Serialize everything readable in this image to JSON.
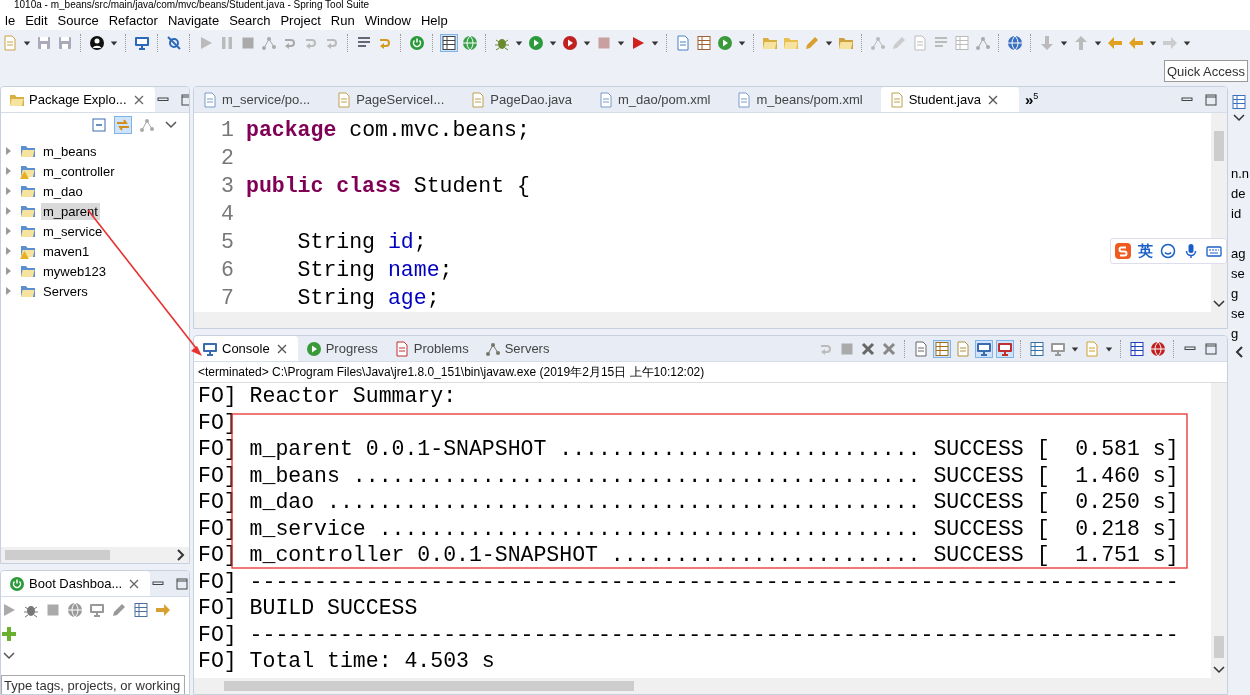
{
  "window": {
    "title": "1010a - m_beans/src/main/java/com/mvc/beans/Student.java - Spring Tool Suite"
  },
  "menu": [
    "le",
    "Edit",
    "Source",
    "Refactor",
    "Navigate",
    "Search",
    "Project",
    "Run",
    "Window",
    "Help"
  ],
  "quick_access": {
    "placeholder": "Quick Access"
  },
  "package_explorer": {
    "title": "Package Explo...",
    "items": [
      {
        "label": "m_beans",
        "selected": false,
        "warning": false
      },
      {
        "label": "m_controller",
        "selected": false,
        "warning": true
      },
      {
        "label": "m_dao",
        "selected": false,
        "warning": false
      },
      {
        "label": "m_parent",
        "selected": true,
        "warning": false
      },
      {
        "label": "m_service",
        "selected": false,
        "warning": false
      },
      {
        "label": "maven1",
        "selected": false,
        "warning": true
      },
      {
        "label": "myweb123",
        "selected": false,
        "warning": false
      },
      {
        "label": "Servers",
        "selected": false,
        "warning": false
      }
    ]
  },
  "boot_dashboard": {
    "title": "Boot Dashboa...",
    "filter": {
      "placeholder": "Type tags, projects, or working"
    }
  },
  "editor": {
    "tabs": [
      {
        "label": "m_service/po...",
        "kind": "xml",
        "selected": false
      },
      {
        "label": "PageServiceI...",
        "kind": "java",
        "selected": false
      },
      {
        "label": "PageDao.java",
        "kind": "java",
        "selected": false
      },
      {
        "label": "m_dao/pom.xml",
        "kind": "xml",
        "selected": false
      },
      {
        "label": "m_beans/pom.xml",
        "kind": "xml",
        "selected": false
      },
      {
        "label": "Student.java",
        "kind": "java",
        "selected": true
      }
    ],
    "overflow": "»",
    "overflow_count": "5",
    "lines": [
      {
        "number": "1",
        "tokens": [
          {
            "text": "package",
            "kind": "keyword"
          },
          {
            "text": " com.mvc.beans;",
            "kind": "plain"
          }
        ]
      },
      {
        "number": "2"
      },
      {
        "number": "3",
        "tokens": [
          {
            "text": "public class",
            "kind": "keyword"
          },
          {
            "text": " Student {",
            "kind": "plain"
          }
        ]
      },
      {
        "number": "4"
      },
      {
        "number": "5",
        "tokens": [
          {
            "text": "    String ",
            "kind": "plain"
          },
          {
            "text": "id",
            "kind": "field"
          },
          {
            "text": ";",
            "kind": "plain"
          }
        ]
      },
      {
        "number": "6",
        "tokens": [
          {
            "text": "    String ",
            "kind": "plain"
          },
          {
            "text": "name",
            "kind": "field"
          },
          {
            "text": ";",
            "kind": "plain"
          }
        ]
      },
      {
        "number": "7",
        "tokens": [
          {
            "text": "    String ",
            "kind": "plain"
          },
          {
            "text": "age",
            "kind": "field"
          },
          {
            "text": ";",
            "kind": "plain"
          }
        ]
      }
    ]
  },
  "outline_fragments": [
    "n.n",
    "de",
    "id",
    "ag",
    "se",
    "g",
    "se",
    "g"
  ],
  "ime": {
    "mode": "英"
  },
  "console": {
    "tabs": [
      {
        "label": "Console",
        "selected": true
      },
      {
        "label": "Progress",
        "selected": false
      },
      {
        "label": "Problems",
        "selected": false
      },
      {
        "label": "Servers",
        "selected": false
      }
    ],
    "status": "<terminated> C:\\Program Files\\Java\\jre1.8.0_151\\bin\\javaw.exe (2019年2月15日 上午10:12:02)",
    "lines": [
      "FO] Reactor Summary:",
      "FO]",
      "FO] m_parent 0.0.1-SNAPSHOT ............................ SUCCESS [  0.581 s]",
      "FO] m_beans ............................................ SUCCESS [  1.460 s]",
      "FO] m_dao .............................................. SUCCESS [  0.250 s]",
      "FO] m_service .......................................... SUCCESS [  0.218 s]",
      "FO] m_controller 0.0.1-SNAPSHOT ........................ SUCCESS [  1.751 s]",
      "FO] ------------------------------------------------------------------------",
      "FO] BUILD SUCCESS",
      "FO] ------------------------------------------------------------------------",
      "FO] Total time: 4.503 s"
    ]
  }
}
